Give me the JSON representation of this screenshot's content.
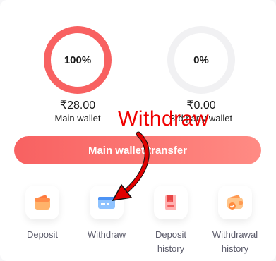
{
  "main_wallet": {
    "percent_label": "100%",
    "percent": 100,
    "amount": "₹28.00",
    "label": "Main wallet"
  },
  "third_party_wallet": {
    "percent_label": "0%",
    "percent": 0,
    "amount": "₹0.00",
    "label": "3rd party wallet"
  },
  "transfer_button": {
    "label": "Main wallet transfer"
  },
  "annotation": {
    "text": "Withdraw"
  },
  "actions": [
    {
      "label_line1": "Deposit",
      "label_line2": "",
      "icon": "wallet-icon"
    },
    {
      "label_line1": "Withdraw",
      "label_line2": "",
      "icon": "card-icon"
    },
    {
      "label_line1": "Deposit",
      "label_line2": "history",
      "icon": "bookmark-icon"
    },
    {
      "label_line1": "Withdrawal",
      "label_line2": "history",
      "icon": "wallet-history-icon"
    }
  ],
  "colors": {
    "accent": "#f86161",
    "gauge_track": "#f1f1f3",
    "annotation": "#f00000"
  }
}
